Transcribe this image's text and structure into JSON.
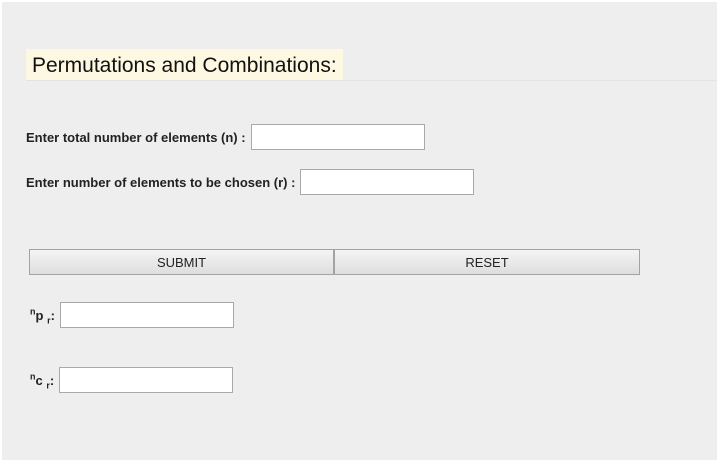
{
  "page": {
    "title": "Permutations and Combinations:"
  },
  "form": {
    "n_label": "Enter total number of elements (n) :",
    "n_value": "",
    "r_label": "Enter number of elements to be chosen (r) :",
    "r_value": "",
    "submit_label": "SUBMIT",
    "reset_label": "RESET"
  },
  "results": {
    "npr": {
      "sup": "n",
      "base": "p",
      "sub": "r",
      "colon": ":",
      "value": ""
    },
    "ncr": {
      "sup": "n",
      "base": "c",
      "sub": "r",
      "colon": ":",
      "value": ""
    }
  },
  "colors": {
    "panel_bg": "#eeeeee",
    "title_bg": "#fdf8e1",
    "input_border": "#a9a9a9",
    "button_border": "#a3a3a3"
  }
}
